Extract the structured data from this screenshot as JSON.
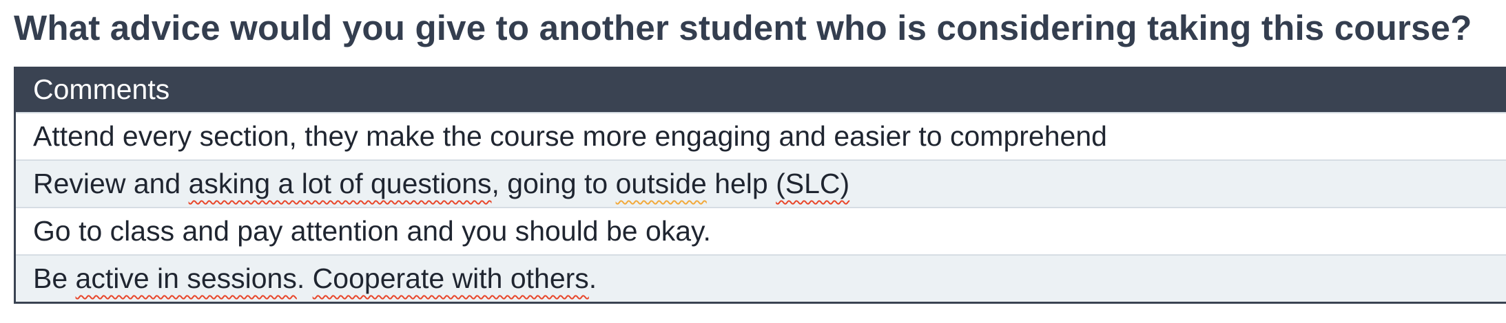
{
  "question": "What advice would you give to another student who is considering taking this course?",
  "table": {
    "header": "Comments",
    "rows": [
      {
        "parts": [
          {
            "text": "Attend every section, they make the course more engaging and easier to comprehend",
            "mark": "none"
          }
        ]
      },
      {
        "parts": [
          {
            "text": "Review and ",
            "mark": "none"
          },
          {
            "text": "asking a lot of questions",
            "mark": "spelling"
          },
          {
            "text": ", going to ",
            "mark": "none"
          },
          {
            "text": "outside",
            "mark": "warning"
          },
          {
            "text": " help ",
            "mark": "none"
          },
          {
            "text": "(SLC)",
            "mark": "spelling"
          }
        ]
      },
      {
        "parts": [
          {
            "text": "Go to class and pay attention and you should be okay.",
            "mark": "none"
          }
        ]
      },
      {
        "parts": [
          {
            "text": "Be ",
            "mark": "none"
          },
          {
            "text": "active in sessions",
            "mark": "spelling"
          },
          {
            "text": ". ",
            "mark": "none"
          },
          {
            "text": "Cooperate with others",
            "mark": "spelling"
          },
          {
            "text": ".",
            "mark": "none"
          }
        ]
      }
    ]
  },
  "colors": {
    "header_bg": "#3a4352",
    "stripe_bg": "#ecf1f4",
    "spelling_underline": "#e8462a",
    "warning_underline": "#f2a93b"
  }
}
